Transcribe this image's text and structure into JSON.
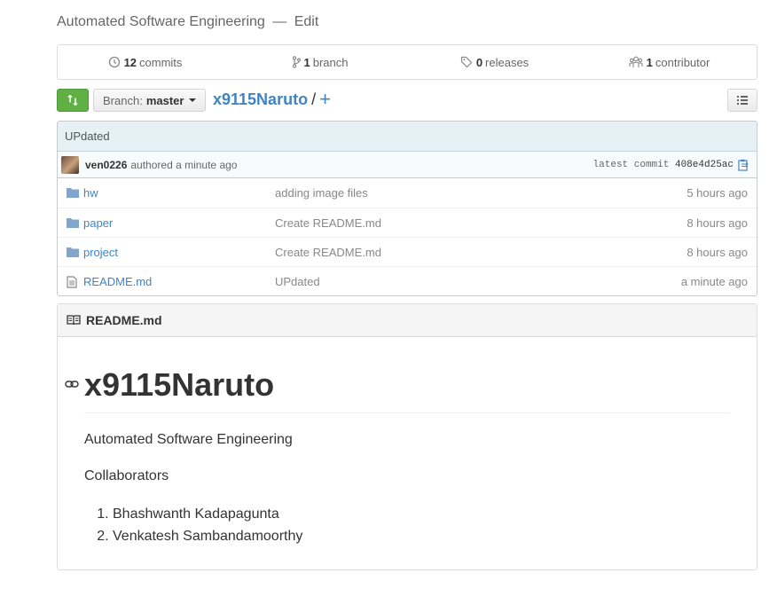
{
  "repo_description": {
    "text": "Automated Software Engineering",
    "separator": "—",
    "edit_label": "Edit"
  },
  "summary": {
    "commits": {
      "count": "12",
      "label": "commits"
    },
    "branches": {
      "count": "1",
      "label": "branch"
    },
    "releases": {
      "count": "0",
      "label": "releases"
    },
    "contributors": {
      "count": "1",
      "label": "contributor"
    }
  },
  "nav": {
    "branch_prefix": "Branch:",
    "branch_name": "master",
    "repo_name": "x9115Naruto",
    "slash": "/",
    "plus": "+"
  },
  "latest_commit": {
    "message": "UPdated",
    "author": "ven0226",
    "authored": "authored a minute ago",
    "latest_label": "latest commit",
    "sha": "408e4d25ac"
  },
  "files": [
    {
      "name": "hw",
      "type": "folder",
      "message": "adding image files",
      "age": "5 hours ago"
    },
    {
      "name": "paper",
      "type": "folder",
      "message": "Create README.md",
      "age": "8 hours ago"
    },
    {
      "name": "project",
      "type": "folder",
      "message": "Create README.md",
      "age": "8 hours ago"
    },
    {
      "name": "README.md",
      "type": "file",
      "message": "UPdated",
      "age": "a minute ago"
    }
  ],
  "readme": {
    "header": "README.md",
    "title": "x9115Naruto",
    "description": "Automated Software Engineering",
    "collaborators_heading": "Collaborators",
    "collaborators": [
      "Bhashwanth Kadapagunta",
      "Venkatesh Sambandamoorthy"
    ]
  },
  "colors": {
    "link": "#4183c4",
    "compare_button": "#60b044",
    "commit_bar": "#e6f1f6"
  }
}
